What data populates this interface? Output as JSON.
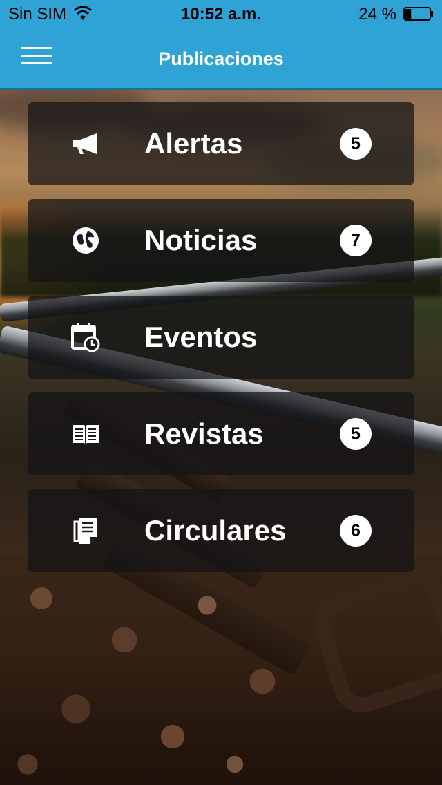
{
  "status_bar": {
    "carrier": "Sin SIM",
    "time": "10:52 a.m.",
    "battery_percent": "24 %",
    "battery_level": 0.24
  },
  "nav": {
    "title": "Publicaciones",
    "menu_icon": "hamburger-menu-icon"
  },
  "theme": {
    "accent": "#2fa2d6",
    "item_bg": "rgba(20,20,22,0.72)",
    "text": "#ffffff"
  },
  "items": [
    {
      "label": "Alertas",
      "icon": "megaphone-icon",
      "badge": "5"
    },
    {
      "label": "Noticias",
      "icon": "globe-icon",
      "badge": "7"
    },
    {
      "label": "Eventos",
      "icon": "calendar-clock-icon",
      "badge": ""
    },
    {
      "label": "Revistas",
      "icon": "open-book-icon",
      "badge": "5"
    },
    {
      "label": "Circulares",
      "icon": "document-icon",
      "badge": "6"
    }
  ]
}
